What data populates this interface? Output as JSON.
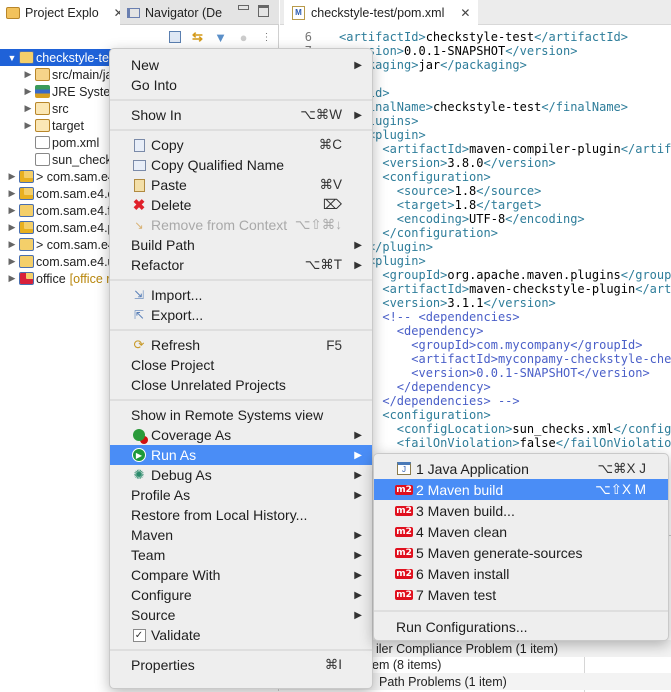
{
  "left_panel": {
    "tabs": [
      {
        "label": "Project Explo",
        "icon": "project-explorer-icon",
        "active": true
      },
      {
        "label": "Navigator (De",
        "icon": "navigator-icon",
        "active": false
      }
    ],
    "tree": [
      {
        "label": "checkstyle-te",
        "level": 0,
        "expand": "open",
        "icon": "maven-project-icon",
        "selected": true
      },
      {
        "label": "src/main/ja",
        "level": 1,
        "expand": "closed",
        "icon": "package-folder-icon"
      },
      {
        "label": "JRE Syster",
        "level": 1,
        "expand": "closed",
        "icon": "library-icon"
      },
      {
        "label": "src",
        "level": 1,
        "expand": "closed",
        "icon": "folder-icon"
      },
      {
        "label": "target",
        "level": 1,
        "expand": "closed",
        "icon": "folder-icon"
      },
      {
        "label": "pom.xml",
        "level": 1,
        "expand": "none",
        "icon": "maven-pom-icon"
      },
      {
        "label": "sun_check",
        "level": 1,
        "expand": "none",
        "icon": "xml-file-icon"
      },
      {
        "label": "> com.sam.e4",
        "level": 0,
        "expand": "closed",
        "icon": "maven-project-warning-icon"
      },
      {
        "label": "com.sam.e4.c",
        "level": 0,
        "expand": "closed",
        "icon": "maven-project-warning-icon"
      },
      {
        "label": "com.sam.e4.fc",
        "level": 0,
        "expand": "closed",
        "icon": "maven-project-icon"
      },
      {
        "label": "com.sam.e4.p",
        "level": 0,
        "expand": "closed",
        "icon": "maven-project-warning-icon"
      },
      {
        "label": "> com.sam.e4",
        "level": 0,
        "expand": "closed",
        "icon": "maven-project-icon"
      },
      {
        "label": "com.sam.e4.u",
        "level": 0,
        "expand": "closed",
        "icon": "maven-project-icon"
      },
      {
        "label": "office",
        "decoration": "[office r",
        "level": 0,
        "expand": "closed",
        "icon": "maven-project-error-icon"
      }
    ]
  },
  "editor": {
    "tab_label": "checkstyle-test/pom.xml",
    "first_line_number": 6,
    "lines": [
      "<artifactId>checkstyle-test</artifactId>",
      "<version>0.0.1-SNAPSHOT</version>",
      "<packaging>jar</packaging>",
      "",
      "<build>",
      "  <finalName>checkstyle-test</finalName>",
      "  <plugins>",
      "    <plugin>",
      "      <artifactId>maven-compiler-plugin</artif",
      "      <version>3.8.0</version>",
      "      <configuration>",
      "        <source>1.8</source>",
      "        <target>1.8</target>",
      "        <encoding>UTF-8</encoding>",
      "      </configuration>",
      "    </plugin>",
      "    <plugin>",
      "      <groupId>org.apache.maven.plugins</group",
      "      <artifactId>maven-checkstyle-plugin</art",
      "      <version>3.1.1</version>",
      "      <!-- <dependencies>",
      "        <dependency>",
      "          <groupId>com.mycompany</groupId>",
      "          <artifactId>myconpamy-checkstyle-che",
      "          <version>0.0.1-SNAPSHOT</version>",
      "        </dependency>",
      "      </dependencies> -->",
      "      <configuration>",
      "        <configLocation>sun_checks.xml</config",
      "        <failOnViolation>false</failOnViolatio"
    ]
  },
  "bottom_panel": {
    "rows": [
      "iler Compliance Problem (1 item)",
      "em (8 items)",
      "Path Problems (1 item)"
    ]
  },
  "context_menu": {
    "items": [
      {
        "label": "New",
        "submenu": true
      },
      {
        "label": "Go Into"
      },
      {
        "separator": true
      },
      {
        "label": "Show In",
        "shortcut": "⌥⌘W",
        "submenu": true
      },
      {
        "separator": true
      },
      {
        "label": "Copy",
        "shortcut": "⌘C",
        "icon": "copy-icon"
      },
      {
        "label": "Copy Qualified Name",
        "icon": "copy-qualified-name-icon"
      },
      {
        "label": "Paste",
        "shortcut": "⌘V",
        "icon": "paste-icon"
      },
      {
        "label": "Delete",
        "shortcut": "⌦",
        "icon": "delete-icon"
      },
      {
        "label": "Remove from Context",
        "shortcut": "⌥⇧⌘↓",
        "icon": "remove-from-context-icon",
        "disabled": true
      },
      {
        "label": "Build Path",
        "submenu": true
      },
      {
        "label": "Refactor",
        "shortcut": "⌥⌘T",
        "submenu": true
      },
      {
        "separator": true
      },
      {
        "label": "Import...",
        "icon": "import-icon"
      },
      {
        "label": "Export...",
        "icon": "export-icon"
      },
      {
        "separator": true
      },
      {
        "label": "Refresh",
        "shortcut": "F5",
        "icon": "refresh-icon"
      },
      {
        "label": "Close Project"
      },
      {
        "label": "Close Unrelated Projects"
      },
      {
        "separator": true
      },
      {
        "label": "Show in Remote Systems view"
      },
      {
        "label": "Coverage As",
        "icon": "coverage-icon",
        "submenu": true
      },
      {
        "label": "Run As",
        "icon": "run-icon",
        "submenu": true,
        "highlighted": true
      },
      {
        "label": "Debug As",
        "icon": "debug-icon",
        "submenu": true
      },
      {
        "label": "Profile As",
        "submenu": true
      },
      {
        "label": "Restore from Local History..."
      },
      {
        "label": "Maven",
        "submenu": true
      },
      {
        "label": "Team",
        "submenu": true
      },
      {
        "label": "Compare With",
        "submenu": true
      },
      {
        "label": "Configure",
        "submenu": true
      },
      {
        "label": "Source",
        "submenu": true
      },
      {
        "label": "Validate",
        "icon": "checkbox-checked-icon"
      },
      {
        "separator": true
      },
      {
        "label": "Properties",
        "shortcut": "⌘I"
      }
    ]
  },
  "run_as_submenu": {
    "items": [
      {
        "label": "1 Java Application",
        "shortcut": "⌥⌘X J",
        "icon": "java-application-icon"
      },
      {
        "label": "2 Maven build",
        "shortcut": "⌥⇧X M",
        "icon": "m2-icon",
        "highlighted": true
      },
      {
        "label": "3 Maven build...",
        "icon": "m2-icon"
      },
      {
        "label": "4 Maven clean",
        "icon": "m2-icon"
      },
      {
        "label": "5 Maven generate-sources",
        "icon": "m2-icon"
      },
      {
        "label": "6 Maven install",
        "icon": "m2-icon"
      },
      {
        "label": "7 Maven test",
        "icon": "m2-icon"
      },
      {
        "separator": true
      },
      {
        "label": "Run Configurations..."
      }
    ]
  },
  "colors": {
    "menu_highlight": "#4a8df6",
    "tree_selection": "#1f62d8",
    "xml_tag": "#2e7d9a",
    "xml_comment": "#4a5fc8",
    "maven_badge": "#e0101e"
  }
}
